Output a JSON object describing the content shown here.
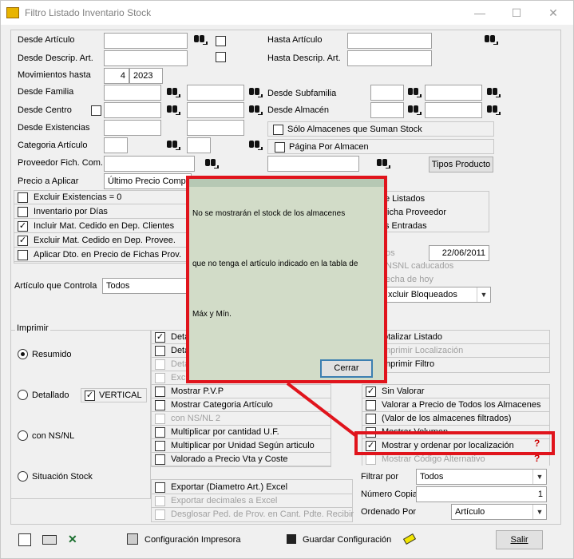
{
  "window": {
    "title": "Filtro Listado Inventario Stock",
    "min": "—",
    "max": "☐",
    "close": "✕"
  },
  "fields": {
    "desde_articulo": "Desde Artículo",
    "hasta_articulo": "Hasta Artículo",
    "desde_descrip": "Desde Descrip. Art.",
    "hasta_descrip": "Hasta Descrip. Art.",
    "movimientos_hasta": "Movimientos hasta",
    "mov_month": "4",
    "mov_year": "2023",
    "desde_familia": "Desde Familia",
    "desde_subfamilia": "Desde Subfamilia",
    "desde_centro": "Desde Centro",
    "desde_almacen": "Desde Almacén",
    "desde_existencias": "Desde Existencias",
    "solo_almacenes": "Sólo Almacenes que Suman Stock",
    "categoria_articulo": "Categoria Artículo",
    "pagina_por_almacen": "Página Por Almacen",
    "proveedor_fich": "Proveedor Fich. Com.",
    "tipos_producto": "Tipos Producto",
    "precio_a_aplicar": "Precio a Aplicar",
    "precio_value": "Último Precio Compra",
    "articulo_controla": "Artículo que Controla",
    "articulo_controla_value": "Todos"
  },
  "left_checks": [
    {
      "label": "Excluir Existencias = 0",
      "checked": false
    },
    {
      "label": "Inventario por Días",
      "checked": false
    },
    {
      "label": "Incluir Mat. Cedido en Dep. Clientes",
      "checked": true
    },
    {
      "label": "Excluir Mat. Cedido en Dep. Provee.",
      "checked": true
    },
    {
      "label": "Aplicar Dto. en Precio de Fichas Prov.",
      "checked": false
    }
  ],
  "right_partial": {
    "r1": "e Listados",
    "r2": "ficha Proveedor",
    "r3": "s Entradas",
    "r4": "os",
    "date": "22/06/2011",
    "r5": "NSNL caducados",
    "r6": "echa de hoy",
    "r7": "xcluir Bloqueados"
  },
  "imprimir": {
    "title": "Imprimir",
    "radios": [
      {
        "label": "Resumido",
        "on": true
      },
      {
        "label": "Detallado",
        "on": false
      },
      {
        "label": "con NS/NL",
        "on": false
      },
      {
        "label": "Situación Stock",
        "on": false
      }
    ],
    "vertical": "VERTICAL"
  },
  "mid_checks": [
    {
      "label": "Deta",
      "checked": true,
      "disabled": false
    },
    {
      "label": "Deta",
      "checked": false,
      "disabled": false
    },
    {
      "label": "Deta",
      "checked": false,
      "disabled": true
    },
    {
      "label": "Excl",
      "checked": false,
      "disabled": true
    },
    {
      "label": "Mostrar P.V.P",
      "checked": false,
      "disabled": false
    },
    {
      "label": "Mostrar Categoria Artículo",
      "checked": false,
      "disabled": false
    },
    {
      "label": "con NS/NL 2",
      "checked": false,
      "disabled": true
    },
    {
      "label": "Multiplicar por cantidad U.F.",
      "checked": false,
      "disabled": false
    },
    {
      "label": "Multiplicar por Unidad Según articulo",
      "checked": false,
      "disabled": false
    },
    {
      "label": "Valorado a Precio Vta y Coste",
      "checked": false,
      "disabled": false
    }
  ],
  "export_checks": [
    {
      "label": "Exportar (Diametro Art.) Excel",
      "disabled": false
    },
    {
      "label": "Exportar decimales a Excel",
      "disabled": true
    },
    {
      "label": "Desglosar Ped. de Prov. en Cant. Pdte. Recibir",
      "disabled": true
    }
  ],
  "right_checks": [
    {
      "label": "otalizar Listado",
      "checked": false,
      "disabled": false
    },
    {
      "label": "mprimir Localización",
      "checked": false,
      "disabled": true
    },
    {
      "label": "mprimir Filtro",
      "checked": false,
      "disabled": false
    },
    {
      "label": "Sin Valorar",
      "checked": true,
      "disabled": false
    },
    {
      "label": "Valorar a Precio de Todos los Almacenes",
      "checked": false,
      "disabled": false
    },
    {
      "label": "(Valor de los almacenes filtrados)",
      "checked": false,
      "disabled": false
    },
    {
      "label": "Mostrar Volumen",
      "checked": false,
      "disabled": false
    },
    {
      "label": "Mostrar y ordenar por localización",
      "checked": true,
      "disabled": false
    },
    {
      "label": "Mostrar Código Alternativo",
      "checked": false,
      "disabled": true
    }
  ],
  "bottom_right": {
    "filtrar_por": "Filtrar por",
    "filtrar_value": "Todos",
    "numero_copias": "Número Copias",
    "copias_value": "1",
    "ordenado_por": "Ordenado Por",
    "ordenado_value": "Artículo"
  },
  "popup": {
    "line1": "No se mostrarán el stock de los almacenes",
    "line2": "que no tenga el artículo indicado en la tabla de",
    "line3": "Máx y Mín.",
    "close": "Cerrar"
  },
  "footer": {
    "config_impresora": "Configuración Impresora",
    "guardar_config": "Guardar Configuración",
    "salir": "Salir"
  }
}
